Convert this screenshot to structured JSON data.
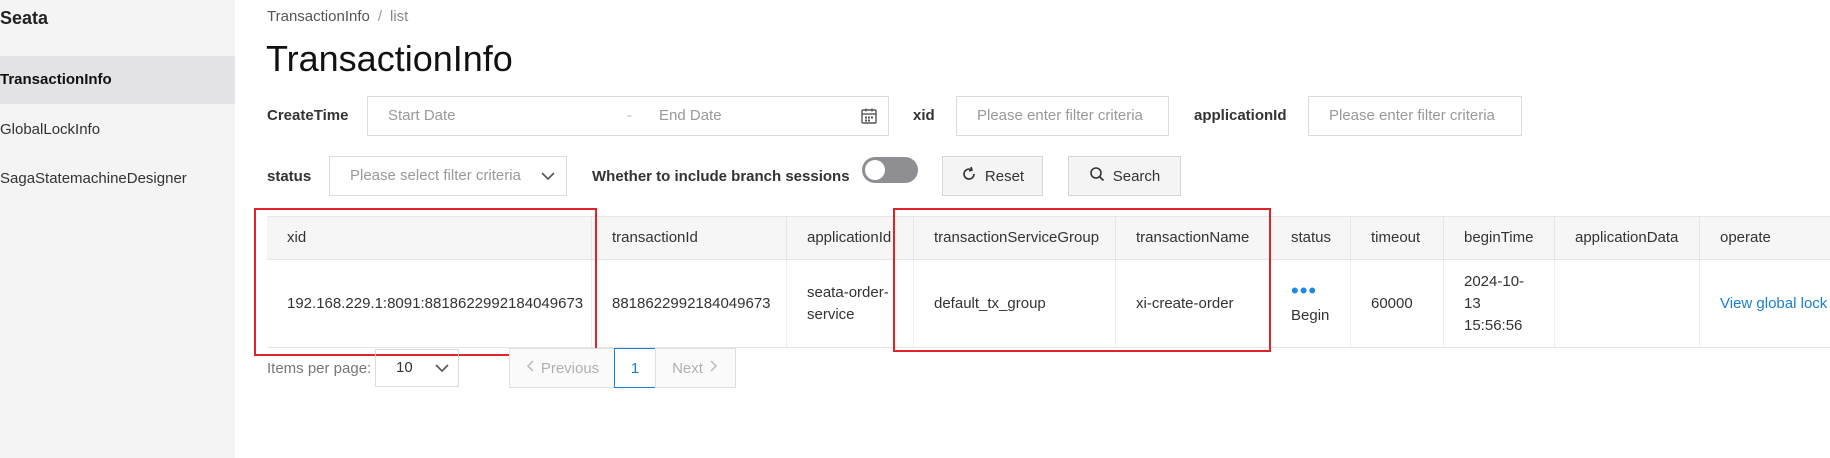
{
  "sidebar": {
    "brand": "Seata",
    "items": [
      {
        "label": "TransactionInfo",
        "active": true
      },
      {
        "label": "GlobalLockInfo"
      },
      {
        "label": "SagaStatemachineDesigner"
      }
    ]
  },
  "breadcrumb": {
    "parent": "TransactionInfo",
    "separator": "/",
    "current": "list"
  },
  "page_title": "TransactionInfo",
  "filters": {
    "create_time_label": "CreateTime",
    "start_placeholder": "Start Date",
    "range_sep": "-",
    "end_placeholder": "End Date",
    "xid_label": "xid",
    "xid_placeholder": "Please enter filter criteria",
    "application_id_label": "applicationId",
    "application_id_placeholder": "Please enter filter criteria",
    "status_label": "status",
    "status_placeholder": "Please select filter criteria",
    "branch_sessions_label": "Whether to include branch sessions",
    "branch_sessions_on": false,
    "reset_label": "Reset",
    "search_label": "Search"
  },
  "table": {
    "columns": [
      "xid",
      "transactionId",
      "applicationId",
      "transactionServiceGroup",
      "transactionName",
      "status",
      "timeout",
      "beginTime",
      "applicationData",
      "operate"
    ],
    "rows": [
      {
        "xid": "192.168.229.1:8091:8818622992184049673",
        "transactionId": "8818622992184049673",
        "applicationId_line1": "seata-order-",
        "applicationId_line2": "service",
        "transactionServiceGroup": "default_tx_group",
        "transactionName": "xi-create-order",
        "status_dots": "•••",
        "status": "Begin",
        "timeout": "60000",
        "beginTime_line1": "2024-10-",
        "beginTime_line2": "13",
        "beginTime_line3": "15:56:56",
        "applicationData": "",
        "operate": "View global lock"
      }
    ]
  },
  "pagination": {
    "items_per_page_label": "Items per page:",
    "page_size": "10",
    "previous": "Previous",
    "current_page": "1",
    "next": "Next"
  },
  "colors": {
    "accent": "#1a7fd4",
    "highlight": "#e0232b",
    "sidebar": "#f4f4f5"
  }
}
